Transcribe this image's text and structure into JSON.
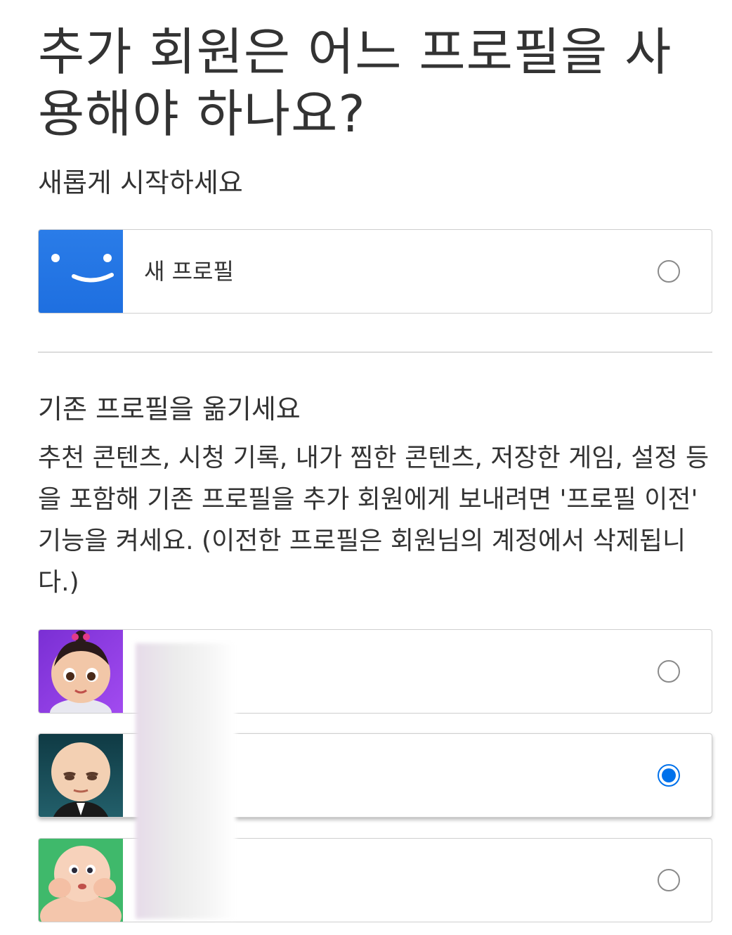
{
  "page": {
    "title": "추가 회원은 어느 프로필을 사용해야 하나요?"
  },
  "new_section": {
    "heading": "새롭게 시작하세요",
    "option": {
      "label": "새 프로필",
      "selected": false,
      "avatar_icon": "smile-face-icon"
    }
  },
  "transfer_section": {
    "heading": "기존 프로필을 옮기세요",
    "description": "추천 콘텐츠, 시청 기록, 내가 찜한 콘텐츠, 저장한 게임, 설정 등을 포함해 기존 프로필을 추가 회원에게 보내려면 '프로필 이전' 기능을 켜세요. (이전한 프로필은 회원님의 계정에서 삭제됩니다.)",
    "profiles": [
      {
        "avatar": "baby-girl-avatar",
        "name": "",
        "selected": false
      },
      {
        "avatar": "boss-baby-avatar",
        "name": "",
        "selected": true
      },
      {
        "avatar": "chubby-baby-avatar",
        "name": "",
        "selected": false
      }
    ]
  },
  "colors": {
    "accent": "#0071eb",
    "new_profile_blue": "#1e73e6",
    "text": "#333333",
    "border": "#cfcfcf"
  }
}
